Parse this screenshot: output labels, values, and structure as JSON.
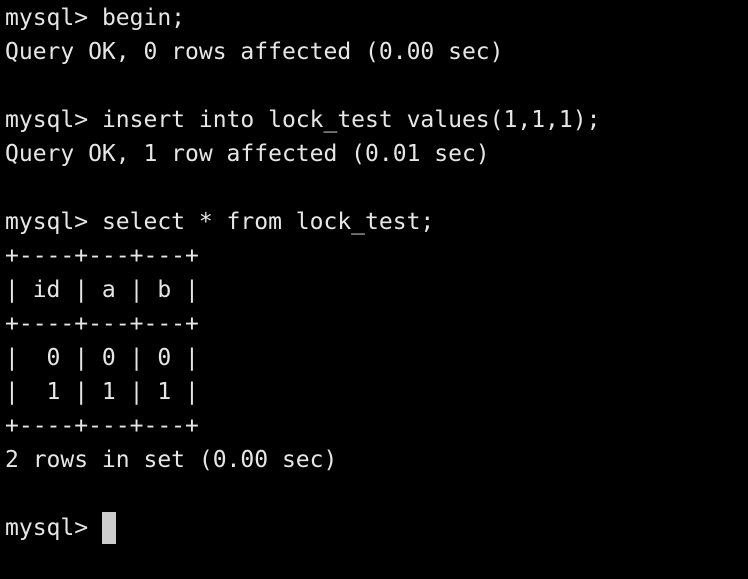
{
  "prompt": "mysql> ",
  "session": [
    {
      "type": "cmd",
      "text": "begin;"
    },
    {
      "type": "out",
      "text": "Query OK, 0 rows affected (0.00 sec)"
    },
    {
      "type": "blank",
      "text": ""
    },
    {
      "type": "cmd",
      "text": "insert into lock_test values(1,1,1);"
    },
    {
      "type": "out",
      "text": "Query OK, 1 row affected (0.01 sec)"
    },
    {
      "type": "blank",
      "text": ""
    },
    {
      "type": "cmd",
      "text": "select * from lock_test;"
    },
    {
      "type": "out",
      "text": "+----+---+---+"
    },
    {
      "type": "out",
      "text": "| id | a | b |"
    },
    {
      "type": "out",
      "text": "+----+---+---+"
    },
    {
      "type": "out",
      "text": "|  0 | 0 | 0 |"
    },
    {
      "type": "out",
      "text": "|  1 | 1 | 1 |"
    },
    {
      "type": "out",
      "text": "+----+---+---+"
    },
    {
      "type": "out",
      "text": "2 rows in set (0.00 sec)"
    },
    {
      "type": "blank",
      "text": ""
    }
  ],
  "current_input": "",
  "colors": {
    "background": "#000000",
    "foreground": "#e6e6e6",
    "cursor": "#cccccc"
  }
}
